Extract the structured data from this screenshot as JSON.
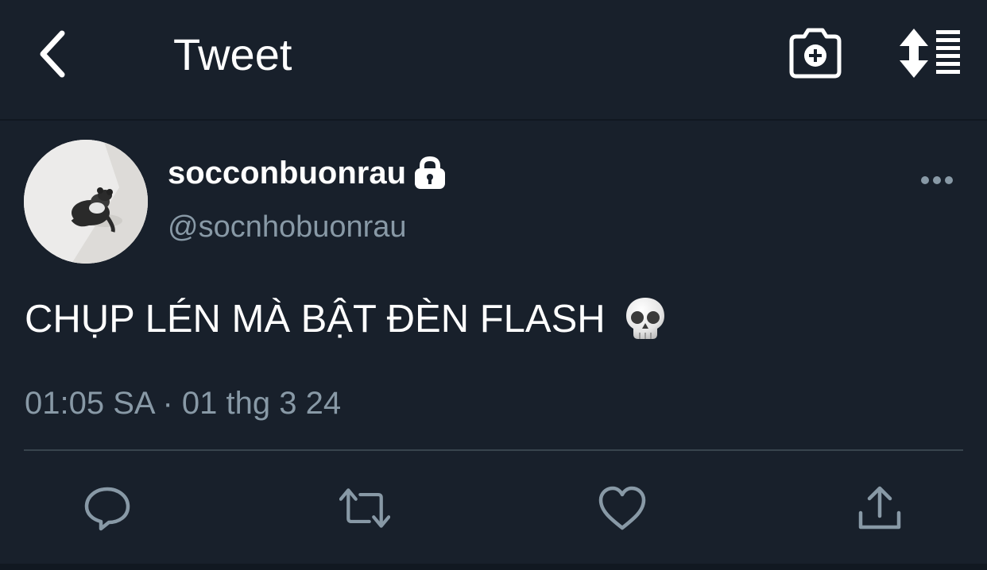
{
  "header": {
    "title": "Tweet",
    "icons": {
      "back": "chevron-left-icon",
      "camera": "camera-plus-icon",
      "sort": "sort-lines-icon"
    }
  },
  "tweet": {
    "author": {
      "display_name": "socconbuonrau",
      "handle": "@socnhobuonrau",
      "protected": true
    },
    "text": "CHỤP LÉN MÀ BẬT ĐÈN FLASH",
    "emoji": "skull-icon",
    "timestamp": "01:05 SA · 01 thg 3 24"
  },
  "actions": {
    "icons": [
      "reply-icon",
      "retweet-icon",
      "like-icon",
      "share-icon"
    ]
  },
  "colors": {
    "background": "#18202b",
    "text_primary": "#ffffff",
    "text_secondary": "#8899a6",
    "icon_secondary": "#8899a6",
    "divider": "#38444d"
  }
}
